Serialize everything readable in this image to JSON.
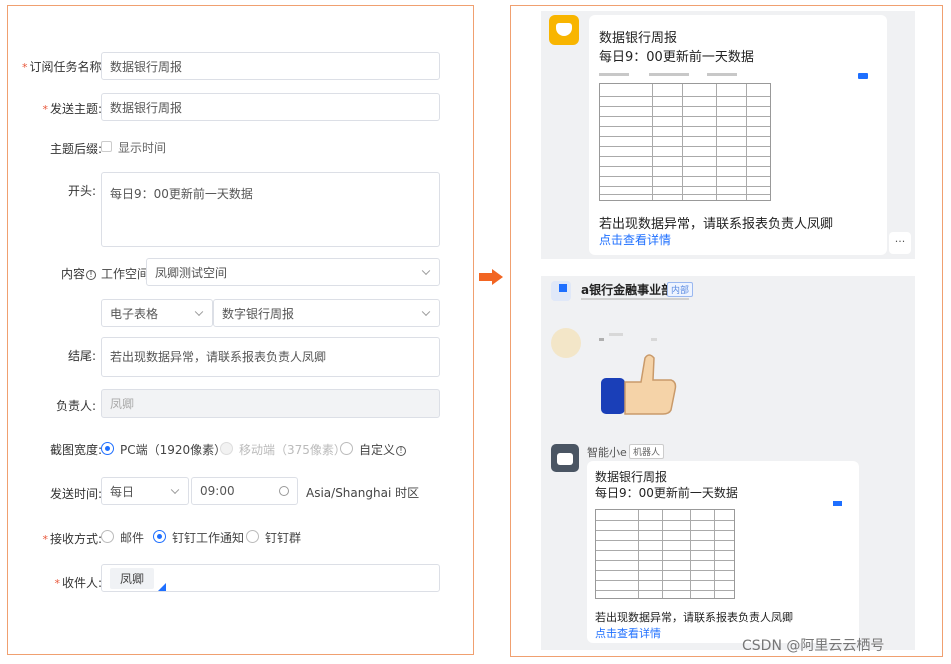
{
  "form": {
    "sub_name_label": "订阅任务名称:",
    "sub_name_value": "数据银行周报",
    "subject_label": "发送主题:",
    "subject_value": "数据银行周报",
    "suffix_label": "主题后缀:",
    "suffix_option": "显示时间",
    "header_label": "开头:",
    "header_value": "每日9：00更新前一天数据",
    "content_label": "内容",
    "workspace_label": "工作空间",
    "workspace_value": "凤卿测试空间",
    "type_value": "电子表格",
    "report_value": "数字银行周报",
    "footer_label": "结尾:",
    "footer_value": "若出现数据异常，请联系报表负责人凤卿",
    "owner_label": "负责人:",
    "owner_value": "凤卿",
    "width_label": "截图宽度:",
    "width_options": [
      "PC端（1920像素）",
      "移动端（375像素）",
      "自定义"
    ],
    "time_label": "发送时间:",
    "freq_value": "每日",
    "time_value": "09:00",
    "timezone": "Asia/Shanghai 时区",
    "recv_label": "接收方式:",
    "recv_options": [
      "邮件",
      "钉钉工作通知",
      "钉钉群"
    ],
    "recipient_label": "收件人:",
    "recipient_value": "凤卿"
  },
  "preview": {
    "card1_title": "数据银行周报",
    "card1_sub": "每日9：00更新前一天数据",
    "card1_footer": "若出现数据异常，请联系报表负责人凤卿",
    "card1_link": "点击查看详情",
    "more": "···",
    "group_name": "a银行金融事业部",
    "group_tag": "内部",
    "bot_name": "智能小e",
    "bot_tag": "机器人",
    "card2_title": "数据银行周报",
    "card2_sub": "每日9：00更新前一天数据",
    "card2_footer": "若出现数据异常，请联系报表负责人凤卿",
    "card2_link": "点击查看详情"
  },
  "watermark": "CSDN @阿里云云栖号",
  "colors": {
    "accent": "#1e6fff",
    "required": "#e8573a",
    "arrow": "#f26522",
    "border": "#f0a070"
  }
}
